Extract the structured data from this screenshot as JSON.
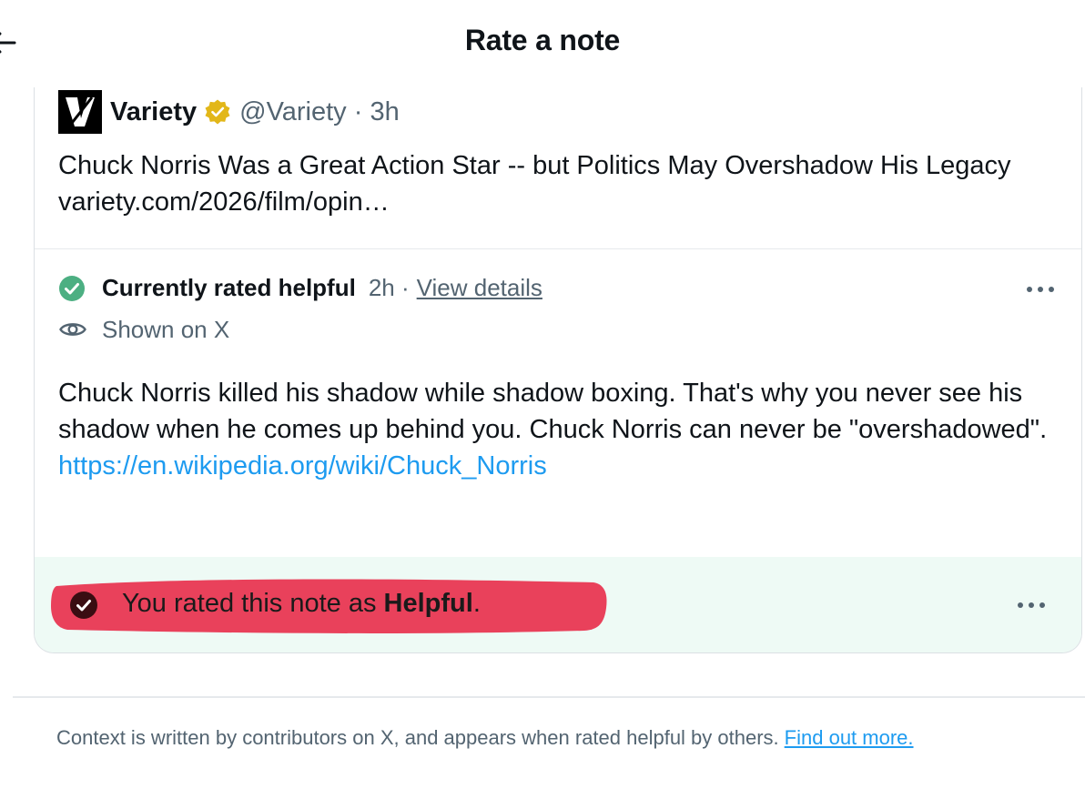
{
  "header": {
    "title": "Rate a note"
  },
  "tweet": {
    "author": "Variety",
    "handle_time": "@Variety · 3h",
    "text": "Chuck Norris Was a Great Action Star -- but Politics May Overshadow His Legacy variety.com/2026/film/opin…"
  },
  "note": {
    "status": "Currently rated helpful",
    "time": "2h ·",
    "details_link": "View details",
    "shown_on": "Shown on X",
    "body": "Chuck Norris killed his shadow while shadow boxing. That's why you never see his shadow when he comes up behind you. Chuck Norris can never be \"overshadowed\".",
    "link": "https://en.wikipedia.org/wiki/Chuck_Norris"
  },
  "rating": {
    "prefix": "You rated this note as ",
    "value": "Helpful",
    "suffix": "."
  },
  "footer": {
    "text": "Context is written by contributors on X, and appears when rated helpful by others.",
    "link": "Find out more."
  },
  "colors": {
    "helpful_green": "#4caf82",
    "link_blue": "#1d9bf0",
    "rated_background": "#eefaf5",
    "highlight_red": "#e8334f",
    "verified_gold": "#e2b719"
  },
  "icons": [
    "back-arrow-icon",
    "variety-logo",
    "verified-badge-icon",
    "check-circle-icon",
    "more-icon",
    "eye-icon",
    "check-circle-dark-icon"
  ]
}
